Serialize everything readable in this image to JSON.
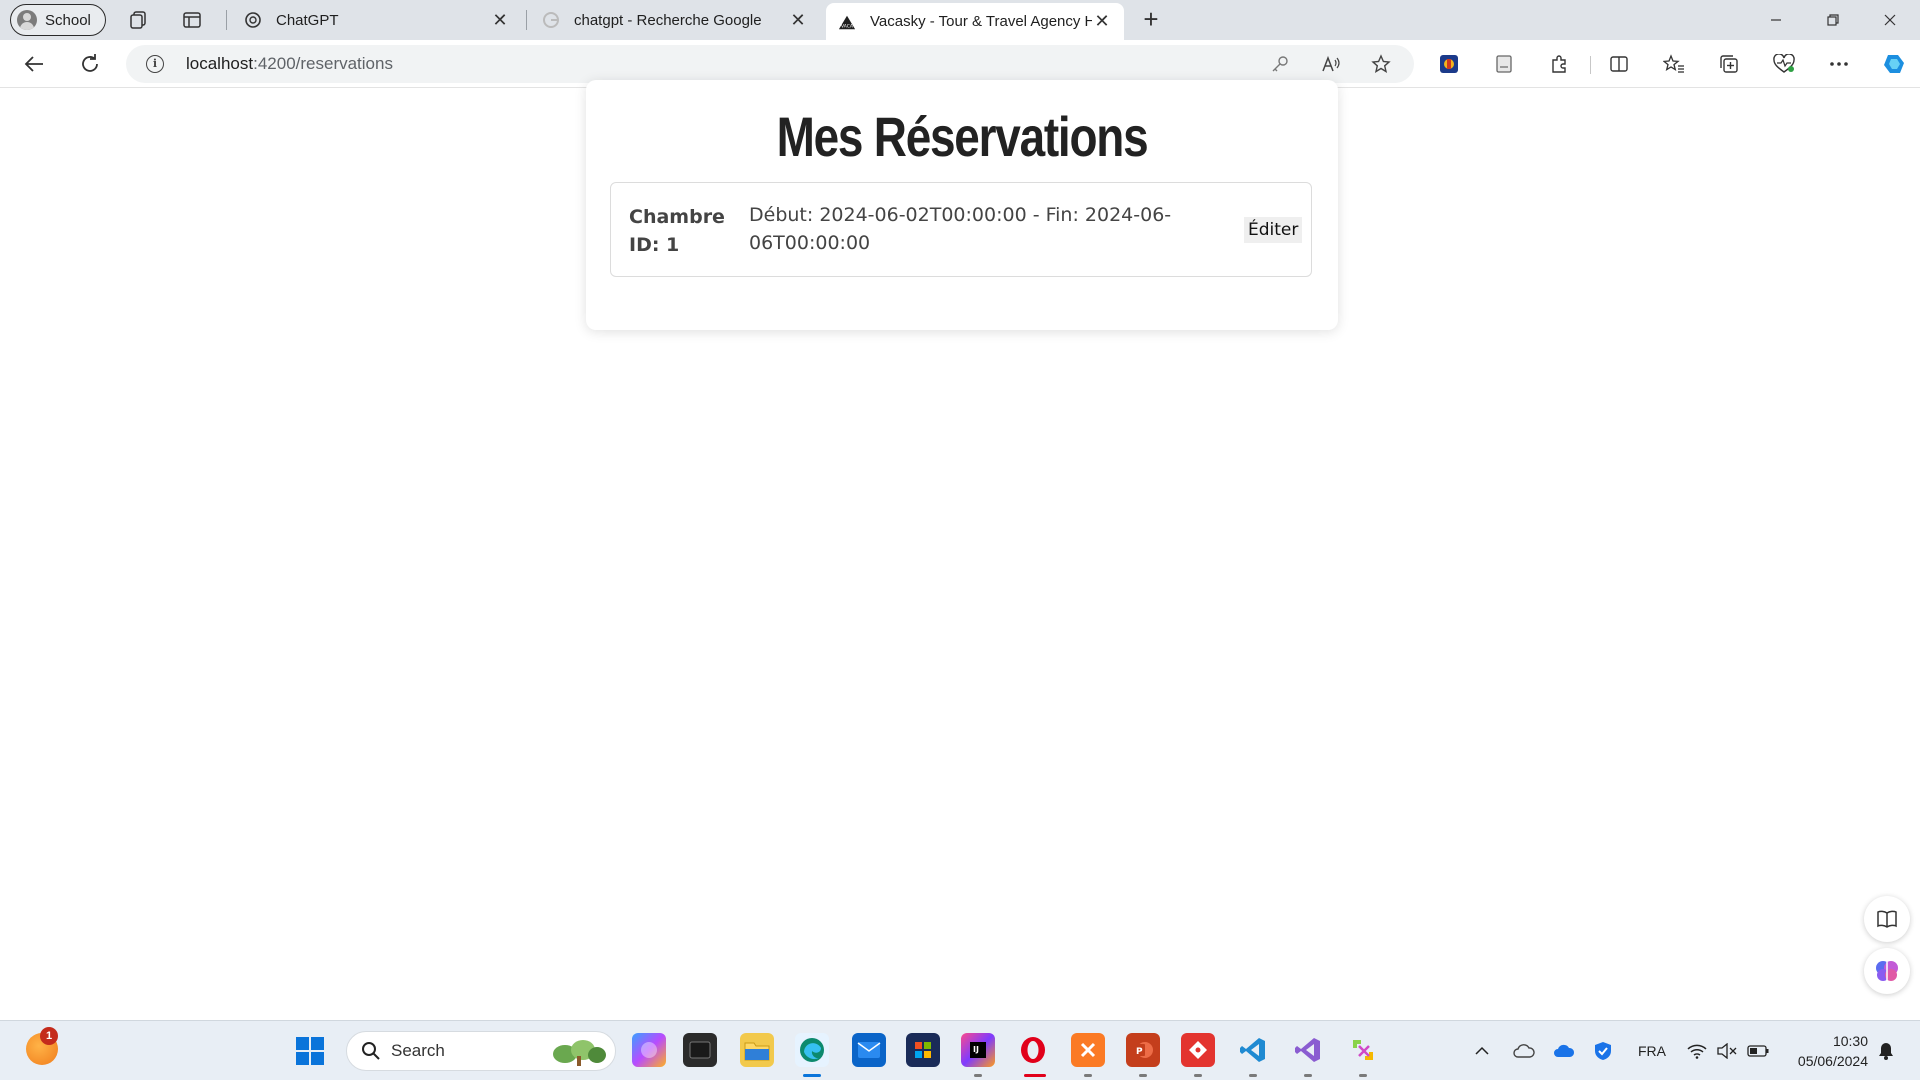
{
  "browser": {
    "profile_label": "School",
    "tabs": [
      {
        "title": "ChatGPT",
        "active": false
      },
      {
        "title": "chatgpt - Recherche Google",
        "active": false
      },
      {
        "title": "Vacasky - Tour & Travel Agency H",
        "active": true
      }
    ],
    "url_host": "localhost",
    "url_path": ":4200/reservations"
  },
  "page": {
    "title": "Mes Réservations",
    "reservations": [
      {
        "room_label": "Chambre ID: 1",
        "dates_text": "Début: 2024-06-02T00:00:00 - Fin: 2024-06-06T00:00:00",
        "edit_label": "Éditer"
      }
    ]
  },
  "taskbar": {
    "weather_badge": "1",
    "search_placeholder": "Search",
    "language": "FRA",
    "time": "10:30",
    "date": "05/06/2024"
  },
  "colors": {
    "accent": "#0a74da",
    "tabstrip": "#dfe3e8",
    "taskbar": "#e8eef5"
  }
}
